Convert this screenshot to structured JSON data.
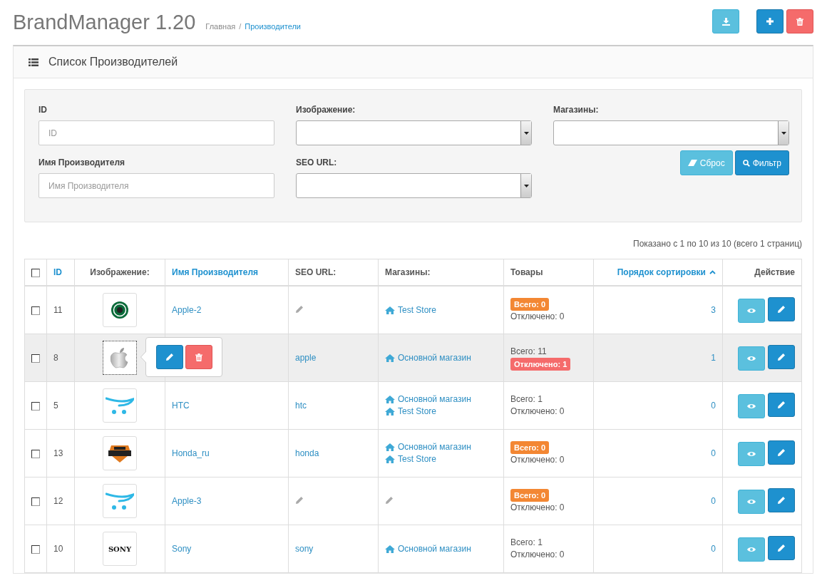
{
  "header": {
    "title": "BrandManager 1.20",
    "separator": "/",
    "breadcrumbs": [
      {
        "label": "Главная",
        "current": false
      },
      {
        "label": "Производители",
        "current": true
      }
    ]
  },
  "toolbar": [
    {
      "kind": "download"
    },
    {
      "kind": "add"
    },
    {
      "kind": "delete"
    }
  ],
  "panel": {
    "title": "Список Производителей"
  },
  "filter": {
    "fields": [
      {
        "label": "ID",
        "kind": "input",
        "placeholder": "ID"
      },
      {
        "label": "Изображение:",
        "kind": "select"
      },
      {
        "label": "Магазины:",
        "kind": "select"
      },
      {
        "label": "Имя Производителя",
        "kind": "input",
        "placeholder": "Имя Производителя"
      },
      {
        "label": "SEO URL:",
        "kind": "select"
      }
    ],
    "buttons": [
      {
        "label": "Сброс",
        "kind": "reset"
      },
      {
        "label": "Фильтр",
        "kind": "filter"
      }
    ]
  },
  "pagination_info": "Показано с 1 по 10 из 10 (всего 1 страниц)",
  "table": {
    "select_all": {
      "checked": false
    },
    "columns": [
      {
        "label": "ID",
        "sortable": true,
        "sorted": false
      },
      {
        "label": "Изображение:",
        "sortable": false,
        "sorted": false
      },
      {
        "label": "Имя Производителя",
        "sortable": true,
        "sorted": false
      },
      {
        "label": "SEO URL:",
        "sortable": false,
        "sorted": false
      },
      {
        "label": "Магазины:",
        "sortable": false,
        "sorted": false
      },
      {
        "label": "Товары",
        "sortable": false,
        "sorted": false
      },
      {
        "label": "Порядок сортировки",
        "sortable": true,
        "sorted": true
      },
      {
        "label": "Действие",
        "sortable": false,
        "sorted": false
      }
    ],
    "rows": [
      {
        "checked": false,
        "highlighted": false,
        "image_menu_open": false,
        "id": "11",
        "kind": "round-emblem",
        "name": "Apple-2",
        "stores": [
          "Test Store"
        ],
        "total": "Всего: 0",
        "total_badge": true,
        "disabled": "Отключено: 0",
        "disabled_badge": false,
        "sort_order": "3"
      },
      {
        "checked": false,
        "highlighted": true,
        "image_menu_open": true,
        "id": "8",
        "kind": "apple",
        "seo": "apple",
        "stores": [
          "Основной магазин"
        ],
        "total": "Всего: 11",
        "total_badge": false,
        "disabled": "Отключено: 1",
        "disabled_badge": true,
        "sort_order": "1"
      },
      {
        "checked": false,
        "highlighted": false,
        "image_menu_open": false,
        "id": "5",
        "kind": "cart",
        "name": "HTC",
        "seo": "htc",
        "stores": [
          "Основной магазин",
          "Test Store"
        ],
        "total": "Всего: 1",
        "total_badge": false,
        "disabled": "Отключено: 0",
        "disabled_badge": false,
        "sort_order": "0"
      },
      {
        "checked": false,
        "highlighted": false,
        "image_menu_open": false,
        "id": "13",
        "kind": "shield-emblem",
        "name": "Honda_ru",
        "seo": "honda",
        "stores": [
          "Основной магазин",
          "Test Store"
        ],
        "total": "Всего: 0",
        "total_badge": true,
        "disabled": "Отключено: 0",
        "disabled_badge": false,
        "sort_order": "0"
      },
      {
        "checked": false,
        "highlighted": false,
        "image_menu_open": false,
        "id": "12",
        "kind": "cart",
        "name": "Apple-3",
        "total": "Всего: 0",
        "total_badge": true,
        "disabled": "Отключено: 0",
        "disabled_badge": false,
        "sort_order": "0"
      },
      {
        "checked": false,
        "highlighted": false,
        "image_menu_open": false,
        "id": "10",
        "kind": "wordmark",
        "logo_text": "SONY",
        "name": "Sony",
        "seo": "sony",
        "stores": [
          "Основной магазин"
        ],
        "total": "Всего: 1",
        "total_badge": false,
        "disabled": "Отключено: 0",
        "disabled_badge": false,
        "sort_order": "0"
      }
    ]
  }
}
